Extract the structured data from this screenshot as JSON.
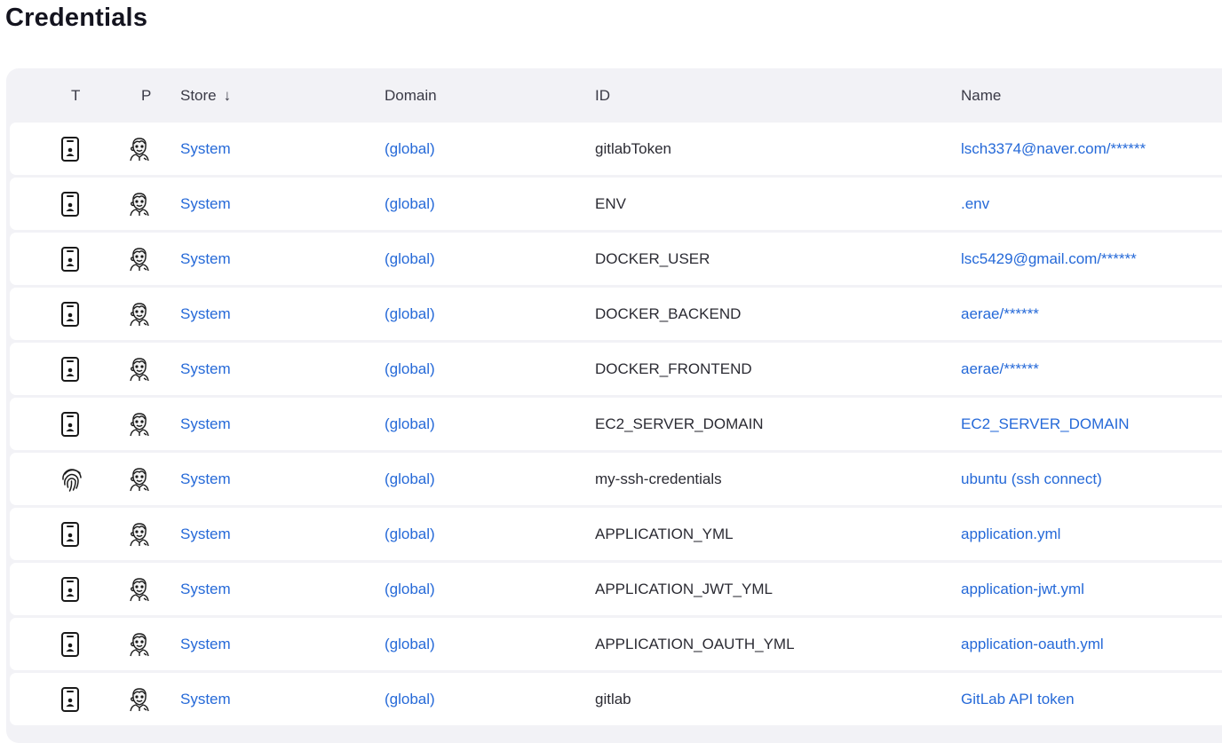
{
  "page": {
    "title": "Credentials"
  },
  "table": {
    "columns": {
      "t": "T",
      "p": "P",
      "store": "Store",
      "store_sort": "↓",
      "domain": "Domain",
      "id": "ID",
      "name": "Name"
    },
    "rows": [
      {
        "type_icon": "mobile-id-icon",
        "provider_icon": "jenkins-icon",
        "store": "System",
        "domain": "(global)",
        "id": "gitlabToken",
        "name": "lsch3374@naver.com/******"
      },
      {
        "type_icon": "mobile-id-icon",
        "provider_icon": "jenkins-icon",
        "store": "System",
        "domain": "(global)",
        "id": "ENV",
        "name": ".env"
      },
      {
        "type_icon": "mobile-id-icon",
        "provider_icon": "jenkins-icon",
        "store": "System",
        "domain": "(global)",
        "id": "DOCKER_USER",
        "name": "lsc5429@gmail.com/******"
      },
      {
        "type_icon": "mobile-id-icon",
        "provider_icon": "jenkins-icon",
        "store": "System",
        "domain": "(global)",
        "id": "DOCKER_BACKEND",
        "name": "aerae/******"
      },
      {
        "type_icon": "mobile-id-icon",
        "provider_icon": "jenkins-icon",
        "store": "System",
        "domain": "(global)",
        "id": "DOCKER_FRONTEND",
        "name": "aerae/******"
      },
      {
        "type_icon": "mobile-id-icon",
        "provider_icon": "jenkins-icon",
        "store": "System",
        "domain": "(global)",
        "id": "EC2_SERVER_DOMAIN",
        "name": "EC2_SERVER_DOMAIN"
      },
      {
        "type_icon": "fingerprint-icon",
        "provider_icon": "jenkins-icon",
        "store": "System",
        "domain": "(global)",
        "id": "my-ssh-credentials",
        "name": "ubuntu (ssh connect)"
      },
      {
        "type_icon": "mobile-id-icon",
        "provider_icon": "jenkins-icon",
        "store": "System",
        "domain": "(global)",
        "id": "APPLICATION_YML",
        "name": "application.yml"
      },
      {
        "type_icon": "mobile-id-icon",
        "provider_icon": "jenkins-icon",
        "store": "System",
        "domain": "(global)",
        "id": "APPLICATION_JWT_YML",
        "name": "application-jwt.yml"
      },
      {
        "type_icon": "mobile-id-icon",
        "provider_icon": "jenkins-icon",
        "store": "System",
        "domain": "(global)",
        "id": "APPLICATION_OAUTH_YML",
        "name": "application-oauth.yml"
      },
      {
        "type_icon": "mobile-id-icon",
        "provider_icon": "jenkins-icon",
        "store": "System",
        "domain": "(global)",
        "id": "gitlab",
        "name": "GitLab API token"
      }
    ]
  },
  "colors": {
    "link": "#2569d8",
    "header_bg": "#f2f2f6",
    "row_bg": "#ffffff",
    "text": "#2b2b33"
  }
}
